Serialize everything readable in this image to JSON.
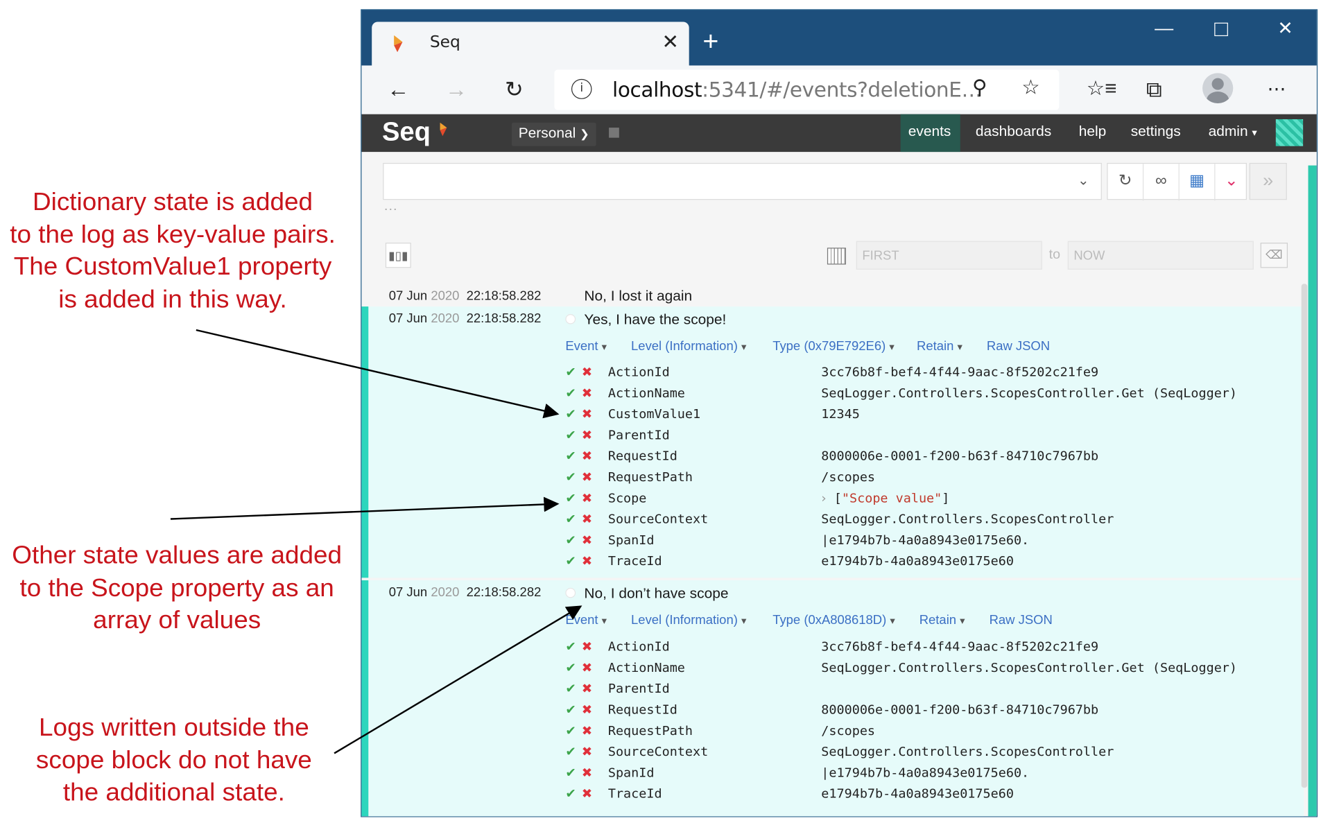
{
  "annotations": {
    "top": [
      "Dictionary state is added",
      "to the log as key-value pairs.",
      "The CustomValue1 property",
      "is added in this way."
    ],
    "middle": [
      "Other state values are added",
      "to the Scope property as an",
      "array of values"
    ],
    "bottom": [
      "Logs written outside the",
      "scope block do not have",
      "the additional state."
    ]
  },
  "browser": {
    "tab_title": "Seq",
    "address_host": "localhost",
    "address_rest": ":5341/#/events?deletionE…",
    "icons": [
      "back-arrow-icon",
      "forward-arrow-icon",
      "refresh-icon",
      "info-icon",
      "zoom-icon",
      "favorite-star-icon",
      "favorites-list-icon",
      "collections-icon",
      "profile-icon",
      "more-icon"
    ]
  },
  "seq": {
    "logo": "Seq",
    "workspace": "Personal",
    "nav": {
      "events": "events",
      "dashboards": "dashboards",
      "help": "help",
      "settings": "settings",
      "admin": "admin"
    },
    "colors": {
      "accent": "#2cc9ad",
      "bar": "#3a3a3a",
      "active_nav": "#28594f"
    }
  },
  "filters": {
    "search_value": "",
    "dots": "···",
    "from_placeholder": "FIRST",
    "to_label": "to",
    "to_placeholder": "NOW"
  },
  "events": [
    {
      "date": "07 Jun",
      "year": "2020",
      "time": "22:18:58.282",
      "message": "No, I lost it again"
    },
    {
      "date": "07 Jun",
      "year": "2020",
      "time": "22:18:58.282",
      "message": "Yes, I have the scope!",
      "tags": {
        "event": "Event",
        "level": "Level (Information)",
        "type": "Type (0x79E792E6)",
        "retain": "Retain",
        "raw": "Raw JSON"
      },
      "props": [
        {
          "key": "ActionId",
          "value": "3cc76b8f-bef4-4f44-9aac-8f5202c21fe9"
        },
        {
          "key": "ActionName",
          "value": "SeqLogger.Controllers.ScopesController.Get (SeqLogger)"
        },
        {
          "key": "CustomValue1",
          "value": "12345"
        },
        {
          "key": "ParentId",
          "value": ""
        },
        {
          "key": "RequestId",
          "value": "8000006e-0001-f200-b63f-84710c7967bb"
        },
        {
          "key": "RequestPath",
          "value": "/scopes"
        },
        {
          "key": "Scope",
          "value": "[\"Scope value\"]",
          "array": true,
          "open": "[",
          "str": "\"Scope value\"",
          "close": "]"
        },
        {
          "key": "SourceContext",
          "value": "SeqLogger.Controllers.ScopesController"
        },
        {
          "key": "SpanId",
          "value": "|e1794b7b-4a0a8943e0175e60."
        },
        {
          "key": "TraceId",
          "value": "e1794b7b-4a0a8943e0175e60"
        }
      ]
    },
    {
      "date": "07 Jun",
      "year": "2020",
      "time": "22:18:58.282",
      "message": "No, I don’t have scope",
      "tags": {
        "event": "Event",
        "level": "Level (Information)",
        "type": "Type (0xA808618D)",
        "retain": "Retain",
        "raw": "Raw JSON"
      },
      "props": [
        {
          "key": "ActionId",
          "value": "3cc76b8f-bef4-4f44-9aac-8f5202c21fe9"
        },
        {
          "key": "ActionName",
          "value": "SeqLogger.Controllers.ScopesController.Get (SeqLogger)"
        },
        {
          "key": "ParentId",
          "value": ""
        },
        {
          "key": "RequestId",
          "value": "8000006e-0001-f200-b63f-84710c7967bb"
        },
        {
          "key": "RequestPath",
          "value": "/scopes"
        },
        {
          "key": "SourceContext",
          "value": "SeqLogger.Controllers.ScopesController"
        },
        {
          "key": "SpanId",
          "value": "|e1794b7b-4a0a8943e0175e60."
        },
        {
          "key": "TraceId",
          "value": "e1794b7b-4a0a8943e0175e60"
        }
      ]
    }
  ]
}
